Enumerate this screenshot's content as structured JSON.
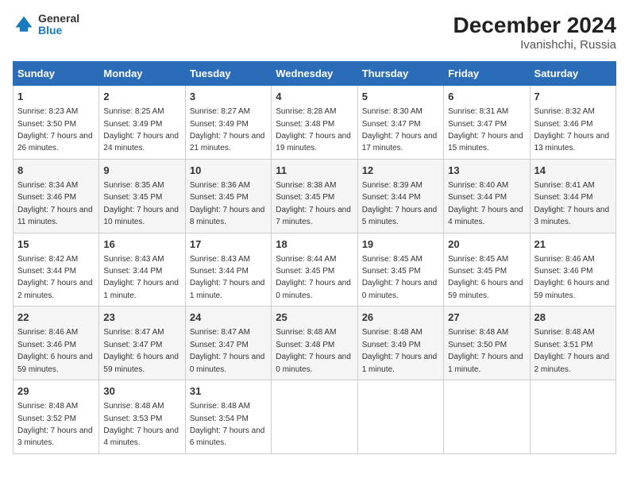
{
  "header": {
    "logo_line1": "General",
    "logo_line2": "Blue",
    "title": "December 2024",
    "subtitle": "Ivanishchi, Russia"
  },
  "weekdays": [
    "Sunday",
    "Monday",
    "Tuesday",
    "Wednesday",
    "Thursday",
    "Friday",
    "Saturday"
  ],
  "weeks": [
    [
      {
        "day": "1",
        "sunrise": "8:23 AM",
        "sunset": "3:50 PM",
        "daylight": "7 hours and 26 minutes."
      },
      {
        "day": "2",
        "sunrise": "8:25 AM",
        "sunset": "3:49 PM",
        "daylight": "7 hours and 24 minutes."
      },
      {
        "day": "3",
        "sunrise": "8:27 AM",
        "sunset": "3:49 PM",
        "daylight": "7 hours and 21 minutes."
      },
      {
        "day": "4",
        "sunrise": "8:28 AM",
        "sunset": "3:48 PM",
        "daylight": "7 hours and 19 minutes."
      },
      {
        "day": "5",
        "sunrise": "8:30 AM",
        "sunset": "3:47 PM",
        "daylight": "7 hours and 17 minutes."
      },
      {
        "day": "6",
        "sunrise": "8:31 AM",
        "sunset": "3:47 PM",
        "daylight": "7 hours and 15 minutes."
      },
      {
        "day": "7",
        "sunrise": "8:32 AM",
        "sunset": "3:46 PM",
        "daylight": "7 hours and 13 minutes."
      }
    ],
    [
      {
        "day": "8",
        "sunrise": "8:34 AM",
        "sunset": "3:46 PM",
        "daylight": "7 hours and 11 minutes."
      },
      {
        "day": "9",
        "sunrise": "8:35 AM",
        "sunset": "3:45 PM",
        "daylight": "7 hours and 10 minutes."
      },
      {
        "day": "10",
        "sunrise": "8:36 AM",
        "sunset": "3:45 PM",
        "daylight": "7 hours and 8 minutes."
      },
      {
        "day": "11",
        "sunrise": "8:38 AM",
        "sunset": "3:45 PM",
        "daylight": "7 hours and 7 minutes."
      },
      {
        "day": "12",
        "sunrise": "8:39 AM",
        "sunset": "3:44 PM",
        "daylight": "7 hours and 5 minutes."
      },
      {
        "day": "13",
        "sunrise": "8:40 AM",
        "sunset": "3:44 PM",
        "daylight": "7 hours and 4 minutes."
      },
      {
        "day": "14",
        "sunrise": "8:41 AM",
        "sunset": "3:44 PM",
        "daylight": "7 hours and 3 minutes."
      }
    ],
    [
      {
        "day": "15",
        "sunrise": "8:42 AM",
        "sunset": "3:44 PM",
        "daylight": "7 hours and 2 minutes."
      },
      {
        "day": "16",
        "sunrise": "8:43 AM",
        "sunset": "3:44 PM",
        "daylight": "7 hours and 1 minute."
      },
      {
        "day": "17",
        "sunrise": "8:43 AM",
        "sunset": "3:44 PM",
        "daylight": "7 hours and 1 minute."
      },
      {
        "day": "18",
        "sunrise": "8:44 AM",
        "sunset": "3:45 PM",
        "daylight": "7 hours and 0 minutes."
      },
      {
        "day": "19",
        "sunrise": "8:45 AM",
        "sunset": "3:45 PM",
        "daylight": "7 hours and 0 minutes."
      },
      {
        "day": "20",
        "sunrise": "8:45 AM",
        "sunset": "3:45 PM",
        "daylight": "6 hours and 59 minutes."
      },
      {
        "day": "21",
        "sunrise": "8:46 AM",
        "sunset": "3:46 PM",
        "daylight": "6 hours and 59 minutes."
      }
    ],
    [
      {
        "day": "22",
        "sunrise": "8:46 AM",
        "sunset": "3:46 PM",
        "daylight": "6 hours and 59 minutes."
      },
      {
        "day": "23",
        "sunrise": "8:47 AM",
        "sunset": "3:47 PM",
        "daylight": "6 hours and 59 minutes."
      },
      {
        "day": "24",
        "sunrise": "8:47 AM",
        "sunset": "3:47 PM",
        "daylight": "7 hours and 0 minutes."
      },
      {
        "day": "25",
        "sunrise": "8:48 AM",
        "sunset": "3:48 PM",
        "daylight": "7 hours and 0 minutes."
      },
      {
        "day": "26",
        "sunrise": "8:48 AM",
        "sunset": "3:49 PM",
        "daylight": "7 hours and 1 minute."
      },
      {
        "day": "27",
        "sunrise": "8:48 AM",
        "sunset": "3:50 PM",
        "daylight": "7 hours and 1 minute."
      },
      {
        "day": "28",
        "sunrise": "8:48 AM",
        "sunset": "3:51 PM",
        "daylight": "7 hours and 2 minutes."
      }
    ],
    [
      {
        "day": "29",
        "sunrise": "8:48 AM",
        "sunset": "3:52 PM",
        "daylight": "7 hours and 3 minutes."
      },
      {
        "day": "30",
        "sunrise": "8:48 AM",
        "sunset": "3:53 PM",
        "daylight": "7 hours and 4 minutes."
      },
      {
        "day": "31",
        "sunrise": "8:48 AM",
        "sunset": "3:54 PM",
        "daylight": "7 hours and 6 minutes."
      },
      null,
      null,
      null,
      null
    ]
  ]
}
